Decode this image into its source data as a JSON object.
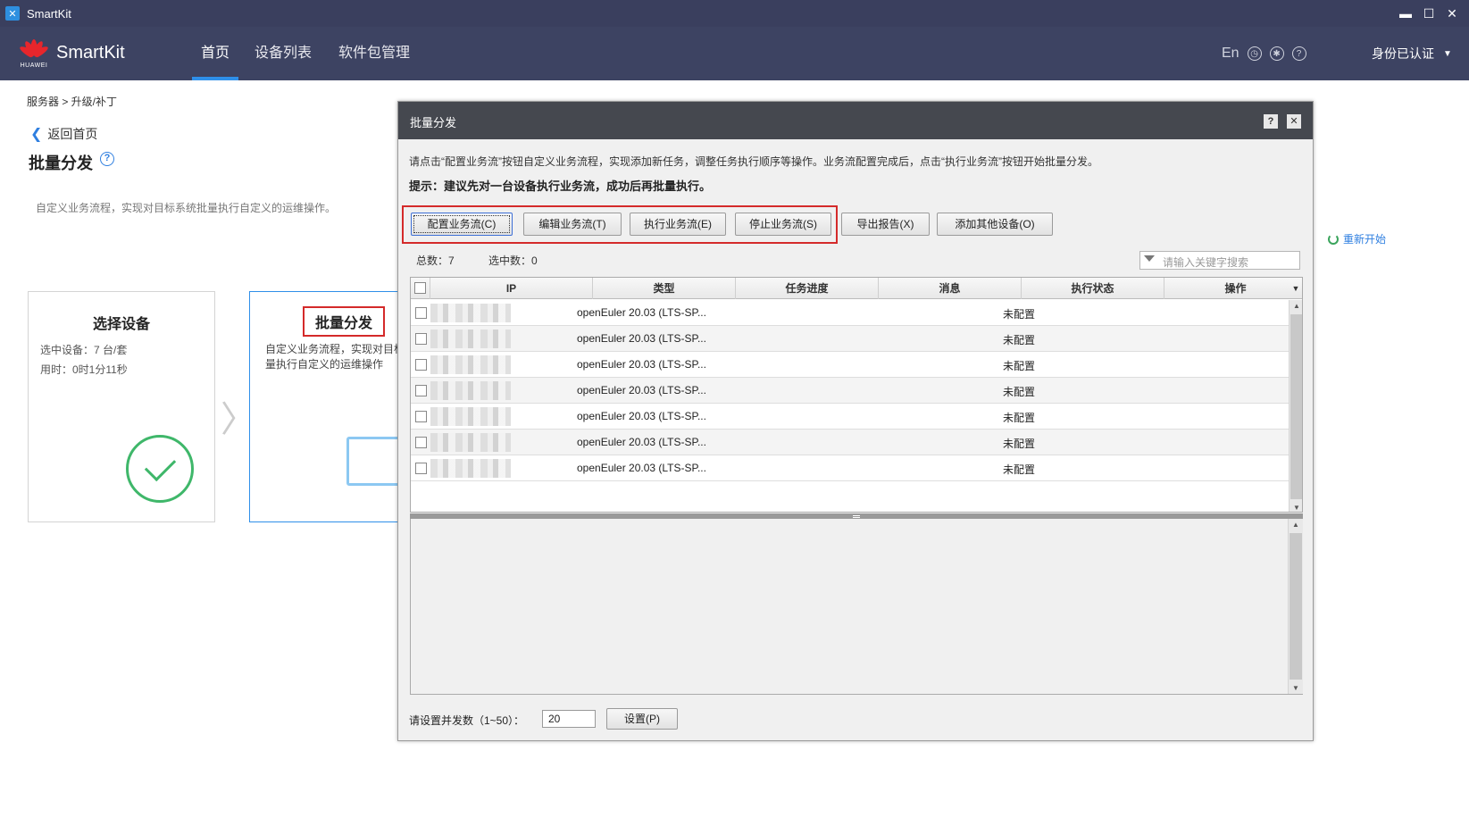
{
  "window": {
    "title": "SmartKit",
    "min": "▬",
    "max": "☐",
    "close": "✕"
  },
  "nav": {
    "brand": "SmartKit",
    "logo_text": "HUAWEI",
    "tabs": [
      "首页",
      "设备列表",
      "软件包管理"
    ],
    "active_tab": "首页",
    "lang": "En",
    "auth": "身份已认证",
    "icons": [
      "clock-icon",
      "gear-icon",
      "help-icon"
    ]
  },
  "page": {
    "breadcrumb": "服务器 > 升级/补丁",
    "back": "返回首页",
    "title": "批量分发",
    "help": "?",
    "description": "自定义业务流程，实现对目标系统批量执行自定义的运维操作。",
    "restart": "重新开始",
    "steps": {
      "select": {
        "title": "选择设备",
        "selected": "选中设备：7 台/套",
        "elapsed": "用时：0时1分11秒"
      },
      "batch": {
        "title": "批量分发",
        "description": "自定义业务流程，实现对目标系统批量执行自定义的运维操作"
      }
    }
  },
  "dialog": {
    "title": "批量分发",
    "help": "?",
    "close": "✕",
    "info": "请点击“配置业务流”按钮自定义业务流程，实现添加新任务，调整任务执行顺序等操作。业务流配置完成后，点击“执行业务流”按钮开始批量分发。",
    "hint": "提示：建议先对一台设备执行业务流，成功后再批量执行。",
    "buttons": {
      "configure": "配置业务流(C)",
      "edit": "编辑业务流(T)",
      "execute": "执行业务流(E)",
      "stop": "停止业务流(S)",
      "export": "导出报告(X)",
      "add_device": "添加其他设备(O)"
    },
    "total": "总数：7",
    "selected": "选中数：0",
    "search_placeholder": "请输入关键字搜索",
    "columns": [
      "IP",
      "类型",
      "任务进度",
      "消息",
      "执行状态",
      "操作"
    ],
    "rows": [
      {
        "type": "openEuler 20.03 (LTS-SP...",
        "status": "未配置"
      },
      {
        "type": "openEuler 20.03 (LTS-SP...",
        "status": "未配置"
      },
      {
        "type": "openEuler 20.03 (LTS-SP...",
        "status": "未配置"
      },
      {
        "type": "openEuler 20.03 (LTS-SP...",
        "status": "未配置"
      },
      {
        "type": "openEuler 20.03 (LTS-SP...",
        "status": "未配置"
      },
      {
        "type": "openEuler 20.03 (LTS-SP...",
        "status": "未配置"
      },
      {
        "type": "openEuler 20.03 (LTS-SP...",
        "status": "未配置"
      }
    ],
    "concurrency_label": "请设置并发数（1~50）：",
    "concurrency_value": "20",
    "set_button": "设置(P)"
  }
}
